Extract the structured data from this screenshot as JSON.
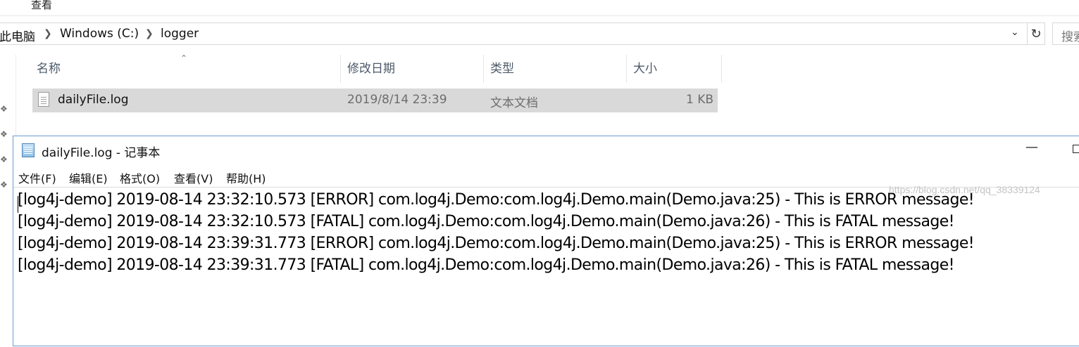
{
  "explorer": {
    "ribbon_tab": "查看",
    "address": {
      "crumbs": [
        "此电脑",
        "Windows (C:)",
        "logger"
      ]
    },
    "search_placeholder": "搜索"
  },
  "columns": [
    "名称",
    "修改日期",
    "类型",
    "大小"
  ],
  "files": [
    {
      "name": "dailyFile.log",
      "modified": "2019/8/14 23:39",
      "type": "文本文档",
      "size": "1 KB"
    }
  ],
  "notepad": {
    "title": "dailyFile.log - 记事本",
    "menu": [
      "文件(F)",
      "编辑(E)",
      "格式(O)",
      "查看(V)",
      "帮助(H)"
    ],
    "lines": [
      "[log4j-demo] 2019-08-14 23:32:10.573 [ERROR] com.log4j.Demo:com.log4j.Demo.main(Demo.java:25) - This is ERROR message!",
      "[log4j-demo] 2019-08-14 23:32:10.573 [FATAL] com.log4j.Demo:com.log4j.Demo.main(Demo.java:26) - This is FATAL message!",
      "[log4j-demo] 2019-08-14 23:39:31.773 [ERROR] com.log4j.Demo:com.log4j.Demo.main(Demo.java:25) - This is ERROR message!",
      "[log4j-demo] 2019-08-14 23:39:31.773 [FATAL] com.log4j.Demo:com.log4j.Demo.main(Demo.java:26) - This is FATAL message!"
    ]
  },
  "watermark": "https://blog.csdn.net/qq_38339124"
}
